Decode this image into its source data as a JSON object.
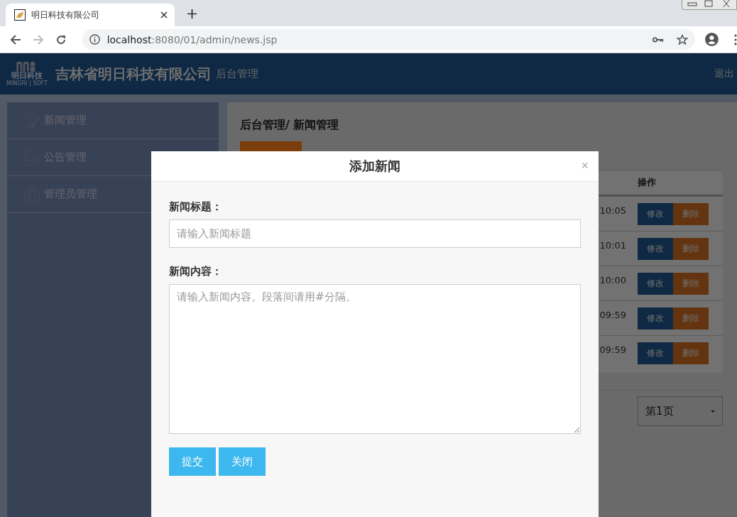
{
  "browser": {
    "tab_title": "明日科技有限公司",
    "url_host": "localhost",
    "url_path": ":8080/01/admin/news.jsp"
  },
  "header": {
    "logo_text": "明日科技",
    "logo_subtext": "MINGRI | SOFT",
    "title": "吉林省明日科技有限公司",
    "subtitle": "后台管理",
    "logout": "退出"
  },
  "sidebar": [
    {
      "label": "新闻管理"
    },
    {
      "label": "公告管理"
    },
    {
      "label": "管理员管理"
    }
  ],
  "breadcrumb": "后台管理/ 新闻管理",
  "table": {
    "columns": [
      "操作"
    ],
    "rows": [
      {
        "time": "10:05",
        "edit": "修改",
        "delete": "删除"
      },
      {
        "time": "10:01",
        "edit": "修改",
        "delete": "删除"
      },
      {
        "time": "10:00",
        "edit": "修改",
        "delete": "删除"
      },
      {
        "time": "09:59",
        "edit": "修改",
        "delete": "删除"
      },
      {
        "time": "09:59",
        "edit": "修改",
        "delete": "删除"
      }
    ]
  },
  "pagination": {
    "page": "第1页"
  },
  "modal": {
    "title": "添加新闻",
    "close": "×",
    "fields": [
      {
        "kind": "input",
        "label": "新闻标题：",
        "placeholder": "请输入新闻标题"
      },
      {
        "kind": "textarea",
        "label": "新闻内容：",
        "placeholder": "请输入新闻内容。段落间请用#分隔。"
      }
    ],
    "buttons": [
      "提交",
      "关闭"
    ]
  }
}
